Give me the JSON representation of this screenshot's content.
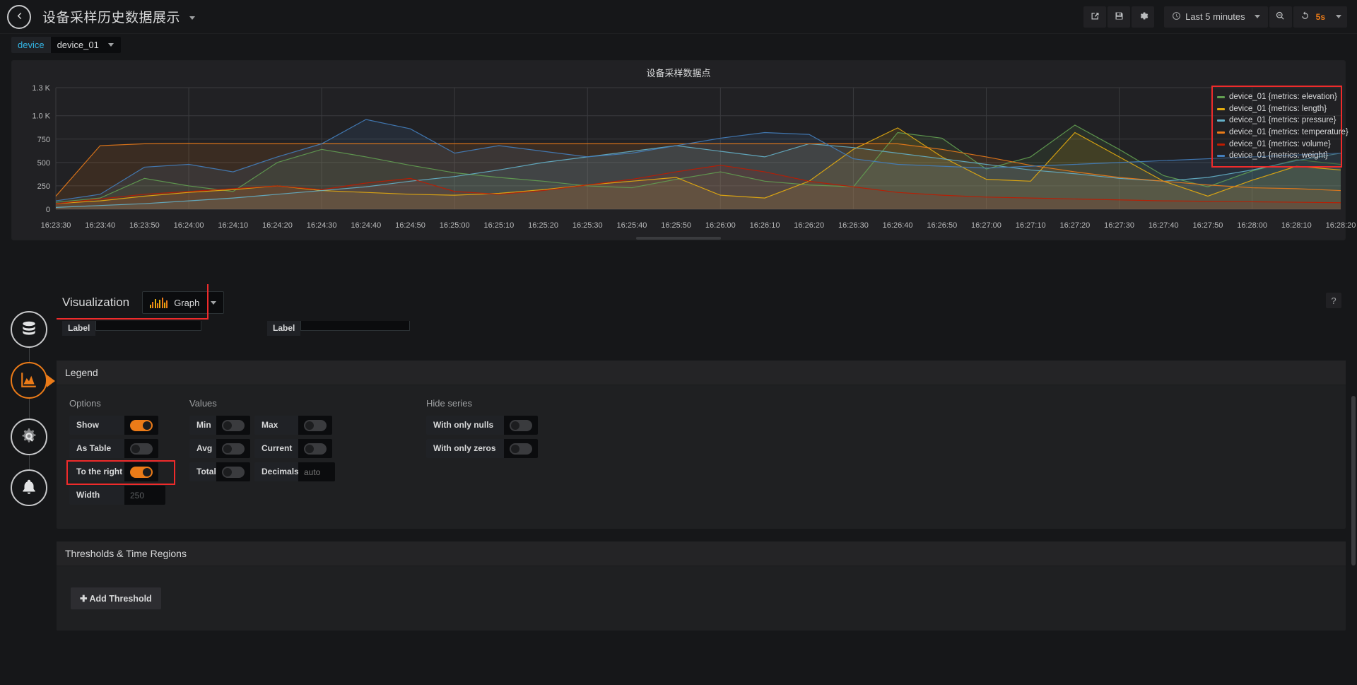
{
  "topnav": {
    "back_icon": "arrow-left-circle-icon",
    "dashboard_title": "设备采样历史数据展示",
    "share_icon": "share-icon",
    "save_icon": "save-icon",
    "settings_icon": "gear-icon",
    "time_range": "Last 5 minutes",
    "clock_icon": "clock-icon",
    "zoom_out_icon": "zoom-out-icon",
    "refresh_icon": "refresh-icon",
    "refresh_interval": "5s"
  },
  "variables": {
    "device": {
      "label": "device",
      "value": "device_01"
    }
  },
  "panel": {
    "title": "设备采样数据点",
    "legend": [
      {
        "label": "device_01 {metrics: elevation}",
        "color": "#629e51"
      },
      {
        "label": "device_01 {metrics: length}",
        "color": "#e5ac0e"
      },
      {
        "label": "device_01 {metrics: pressure}",
        "color": "#64b0c8"
      },
      {
        "label": "device_01 {metrics: temperature}",
        "color": "#eb7b18"
      },
      {
        "label": "device_01 {metrics: volume}",
        "color": "#bf1b00"
      },
      {
        "label": "device_01 {metrics: weight}",
        "color": "#447ebc"
      }
    ]
  },
  "chart_data": {
    "type": "line",
    "title": "设备采样数据点",
    "xlabel": "",
    "ylabel": "",
    "ylim": [
      0,
      1300
    ],
    "grid": true,
    "legend_position": "right",
    "y_ticks": [
      "0",
      "250",
      "500",
      "750",
      "1.0 K",
      "1.3 K"
    ],
    "y_tick_values": [
      0,
      250,
      500,
      750,
      1000,
      1300
    ],
    "x": [
      "16:23:30",
      "16:23:40",
      "16:23:50",
      "16:24:00",
      "16:24:10",
      "16:24:20",
      "16:24:30",
      "16:24:40",
      "16:24:50",
      "16:25:00",
      "16:25:10",
      "16:25:20",
      "16:25:30",
      "16:25:40",
      "16:25:50",
      "16:26:00",
      "16:26:10",
      "16:26:20",
      "16:26:30",
      "16:26:40",
      "16:26:50",
      "16:27:00",
      "16:27:10",
      "16:27:20",
      "16:27:30",
      "16:27:40",
      "16:27:50",
      "16:28:00",
      "16:28:10",
      "16:28:20"
    ],
    "series": [
      {
        "name": "device_01 {metrics: elevation}",
        "color": "#629e51",
        "values": [
          75,
          120,
          330,
          250,
          190,
          500,
          640,
          560,
          470,
          390,
          340,
          300,
          250,
          230,
          320,
          400,
          300,
          260,
          240,
          820,
          760,
          430,
          560,
          900,
          640,
          360,
          240,
          410,
          530,
          480
        ]
      },
      {
        "name": "device_01 {metrics: length}",
        "color": "#e5ac0e",
        "values": [
          60,
          90,
          140,
          180,
          210,
          250,
          200,
          180,
          160,
          150,
          170,
          210,
          260,
          300,
          340,
          150,
          120,
          300,
          640,
          870,
          560,
          320,
          300,
          820,
          560,
          300,
          140,
          310,
          460,
          420
        ]
      },
      {
        "name": "device_01 {metrics: pressure}",
        "color": "#64b0c8",
        "values": [
          20,
          40,
          60,
          90,
          120,
          160,
          200,
          240,
          300,
          350,
          420,
          500,
          560,
          620,
          680,
          620,
          560,
          700,
          660,
          600,
          540,
          480,
          420,
          380,
          330,
          300,
          340,
          420,
          520,
          600
        ]
      },
      {
        "name": "device_01 {metrics: temperature}",
        "color": "#eb7b18",
        "values": [
          140,
          680,
          700,
          705,
          700,
          700,
          700,
          700,
          700,
          700,
          700,
          700,
          700,
          700,
          700,
          700,
          700,
          700,
          700,
          700,
          640,
          560,
          470,
          400,
          340,
          300,
          260,
          230,
          220,
          200
        ]
      },
      {
        "name": "device_01 {metrics: volume}",
        "color": "#bf1b00",
        "values": [
          60,
          110,
          160,
          190,
          220,
          250,
          210,
          280,
          330,
          190,
          160,
          200,
          260,
          320,
          400,
          470,
          400,
          300,
          240,
          180,
          150,
          130,
          120,
          110,
          100,
          90,
          85,
          80,
          75,
          70
        ]
      },
      {
        "name": "device_01 {metrics: weight}",
        "color": "#447ebc",
        "values": [
          90,
          160,
          450,
          480,
          400,
          560,
          700,
          960,
          860,
          600,
          680,
          620,
          560,
          600,
          680,
          760,
          820,
          800,
          540,
          480,
          460,
          440,
          460,
          480,
          500,
          520,
          540,
          560,
          580,
          600
        ]
      }
    ]
  },
  "visualization": {
    "label": "Visualization",
    "selected": "Graph",
    "type_icon": "bar-chart-icon",
    "chevron_icon": "chevron-down-icon",
    "help_icon": "question-mark-icon",
    "partial_field_1": "Label",
    "partial_field_2": "Label"
  },
  "legend_section": {
    "title": "Legend",
    "options": {
      "title": "Options",
      "rows": [
        {
          "label": "Show",
          "state": "on"
        },
        {
          "label": "As Table",
          "state": "off"
        },
        {
          "label": "To the right",
          "state": "on"
        }
      ],
      "width_label": "Width",
      "width_value": "250"
    },
    "values": {
      "title": "Values",
      "left": [
        {
          "label": "Min",
          "state": "off"
        },
        {
          "label": "Avg",
          "state": "off"
        },
        {
          "label": "Total",
          "state": "off"
        }
      ],
      "right": [
        {
          "label": "Max",
          "state": "off"
        },
        {
          "label": "Current",
          "state": "off"
        }
      ],
      "decimals_label": "Decimals",
      "decimals_placeholder": "auto"
    },
    "hide_series": {
      "title": "Hide series",
      "rows": [
        {
          "label": "With only nulls",
          "state": "off"
        },
        {
          "label": "With only zeros",
          "state": "off"
        }
      ]
    }
  },
  "thresholds_section": {
    "title": "Thresholds & Time Regions",
    "add_button": "Add Threshold",
    "plus_icon": "plus-icon"
  },
  "edit_sidebar": [
    {
      "name": "queries",
      "icon": "database-icon",
      "active": false
    },
    {
      "name": "visualization",
      "icon": "graph-area-icon",
      "active": true
    },
    {
      "name": "general",
      "icon": "gear-wrench-icon",
      "active": false
    },
    {
      "name": "alert",
      "icon": "bell-icon",
      "active": false
    }
  ],
  "colors": {
    "accent": "#eb7b18",
    "highlight_box": "#ef2b2b",
    "link": "#33b5e5",
    "panel_bg": "#212124",
    "page_bg": "#161719"
  }
}
